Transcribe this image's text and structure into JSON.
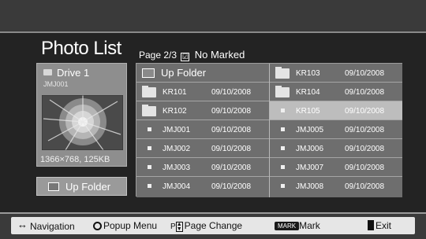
{
  "screen": {
    "title": "Photo List",
    "page_info": "Page 2/3",
    "checkbox_glyph": "☑",
    "marked_status": "No Marked"
  },
  "preview": {
    "drive": "Drive 1",
    "selected_file": "JMJ001",
    "resolution": "1366×768, 125KB"
  },
  "up_folder_button": {
    "label": "Up Folder"
  },
  "files": {
    "left": [
      {
        "type": "upfolder",
        "name": "Up Folder",
        "date": ""
      },
      {
        "type": "folder",
        "name": "KR101",
        "date": "09/10/2008"
      },
      {
        "type": "folder",
        "name": "KR102",
        "date": "09/10/2008"
      },
      {
        "type": "file",
        "name": "JMJ001",
        "date": "09/10/2008"
      },
      {
        "type": "file",
        "name": "JMJ002",
        "date": "09/10/2008"
      },
      {
        "type": "file",
        "name": "JMJ003",
        "date": "09/10/2008"
      },
      {
        "type": "file",
        "name": "JMJ004",
        "date": "09/10/2008"
      }
    ],
    "right": [
      {
        "type": "folder",
        "name": "KR103",
        "date": "09/10/2008"
      },
      {
        "type": "folder",
        "name": "KR104",
        "date": "09/10/2008"
      },
      {
        "type": "file",
        "name": "KR105",
        "date": "09/10/2008",
        "selected": true
      },
      {
        "type": "file",
        "name": "JMJ005",
        "date": "09/10/2008"
      },
      {
        "type": "file",
        "name": "JMJ006",
        "date": "09/10/2008"
      },
      {
        "type": "file",
        "name": "JMJ007",
        "date": "09/10/2008"
      },
      {
        "type": "file",
        "name": "JMJ008",
        "date": "09/10/2008"
      }
    ]
  },
  "help": {
    "navigation": "Navigation",
    "popup_menu": "Popup Menu",
    "p_prefix": "P",
    "page_change": "Page Change",
    "mark_key": "MARK",
    "mark": "Mark",
    "exit": "Exit"
  },
  "colors": {
    "background": "#232323",
    "panel": "#8e8e8e",
    "grid": "#7c7c7c",
    "selected_row": "#bdbdbd",
    "help_strip": "#e6e6e6"
  },
  "icons": [
    "drive-icon",
    "folder-icon",
    "up-folder-icon",
    "file-dot-icon",
    "navigation-icon",
    "popup-menu-icon",
    "page-change-icon",
    "mark-key-icon",
    "exit-icon"
  ]
}
